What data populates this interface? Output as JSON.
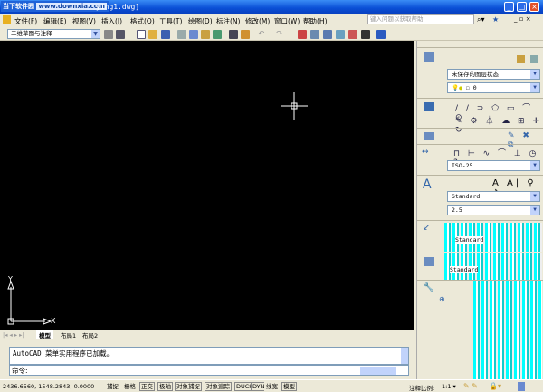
{
  "title": {
    "logo_cn": "当下软件园",
    "logo_url": "www.downxia.com",
    "file": "ying1.dwg]"
  },
  "menu": [
    "文件(F)",
    "编辑(E)",
    "视图(V)",
    "插入(I)",
    "格式(O)",
    "工具(T)",
    "绘图(D)",
    "标注(N)",
    "修改(M)",
    "窗口(W)",
    "帮助(H)"
  ],
  "help_placeholder": "键入问题以获取帮助",
  "workspace": "二维草图与注释",
  "tabs": [
    "模型",
    "布局1",
    "布局2"
  ],
  "command": {
    "history": "AutoCAD 菜单实用程序已加载。",
    "prompt": "命令:"
  },
  "status": {
    "coords": "2436.6560, 1548.2843, 0.0000",
    "toggles": [
      "捕捉",
      "栅格",
      "正交",
      "极轴",
      "对象捕捉",
      "对象追踪",
      "DUCS",
      "DYN",
      "线宽",
      "模型"
    ],
    "annotation_scale_label": "注释比例:",
    "annotation_scale": "1:1"
  },
  "panel": {
    "layer_state": "未保存的图层状态",
    "layer": "0",
    "dimstyle": "ISO-25",
    "textstyle": "Standard",
    "text_height": "2.5",
    "table_style": "Standard",
    "mleader_style": "Standard"
  },
  "ucs": {
    "x": "X",
    "y": "Y"
  }
}
